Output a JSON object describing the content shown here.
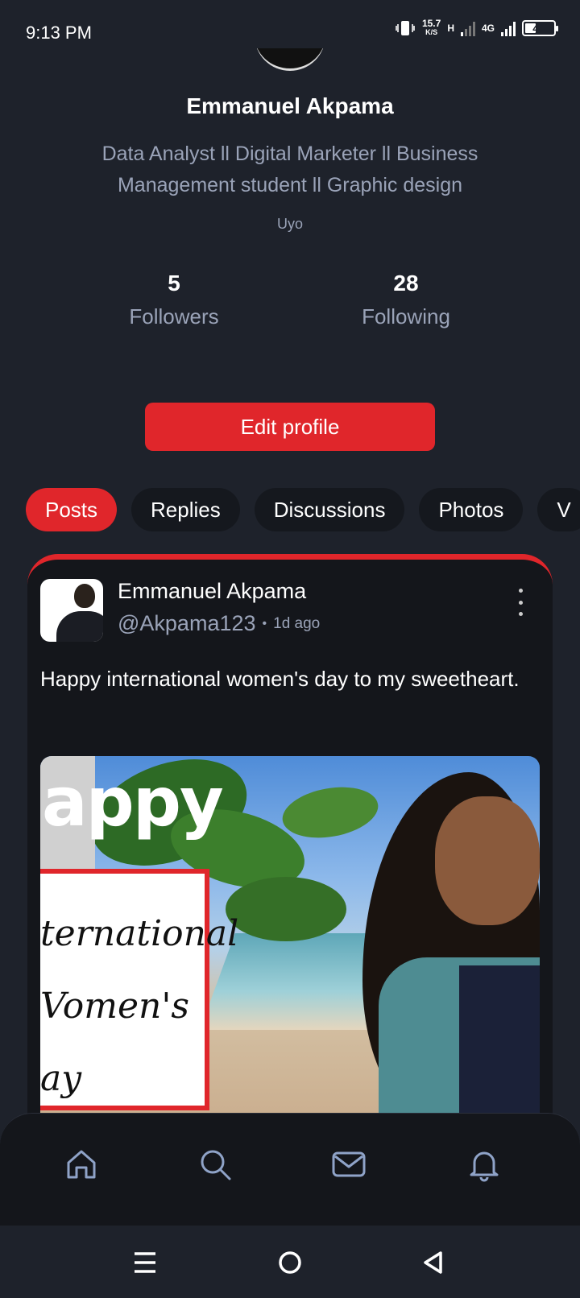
{
  "status_bar": {
    "time": "9:13 PM",
    "speed_value": "15.7",
    "speed_unit": "K/S",
    "network_h": "H",
    "network_4g": "4G",
    "battery": "44",
    "battery_level_percent": 44
  },
  "profile": {
    "name": "Emmanuel Akpama",
    "bio": "Data Analyst ll Digital Marketer ll Business Management student ll Graphic design",
    "location": "Uyo",
    "followers_count": "5",
    "followers_label": "Followers",
    "following_count": "28",
    "following_label": "Following",
    "edit_button": "Edit profile"
  },
  "tabs": [
    {
      "label": "Posts",
      "active": true
    },
    {
      "label": "Replies",
      "active": false
    },
    {
      "label": "Discussions",
      "active": false
    },
    {
      "label": "Photos",
      "active": false
    },
    {
      "label": "V",
      "active": false
    }
  ],
  "post": {
    "author": "Emmanuel Akpama",
    "handle": "@Akpama123",
    "separator": "•",
    "time": "1d ago",
    "text": "Happy international women's day to my sweetheart.",
    "image": {
      "banner_text": "appy",
      "card_text": "ternational\nVomen's\nay"
    }
  },
  "bottom_nav": [
    {
      "icon": "home-icon"
    },
    {
      "icon": "search-icon"
    },
    {
      "icon": "mail-icon"
    },
    {
      "icon": "bell-icon"
    }
  ],
  "system_nav": [
    {
      "icon": "menu-icon"
    },
    {
      "icon": "home-circle-icon"
    },
    {
      "icon": "back-icon"
    }
  ],
  "colors": {
    "background": "#1e222b",
    "accent": "#e0262b",
    "muted_text": "#9aa3b8",
    "card": "#14161b"
  }
}
